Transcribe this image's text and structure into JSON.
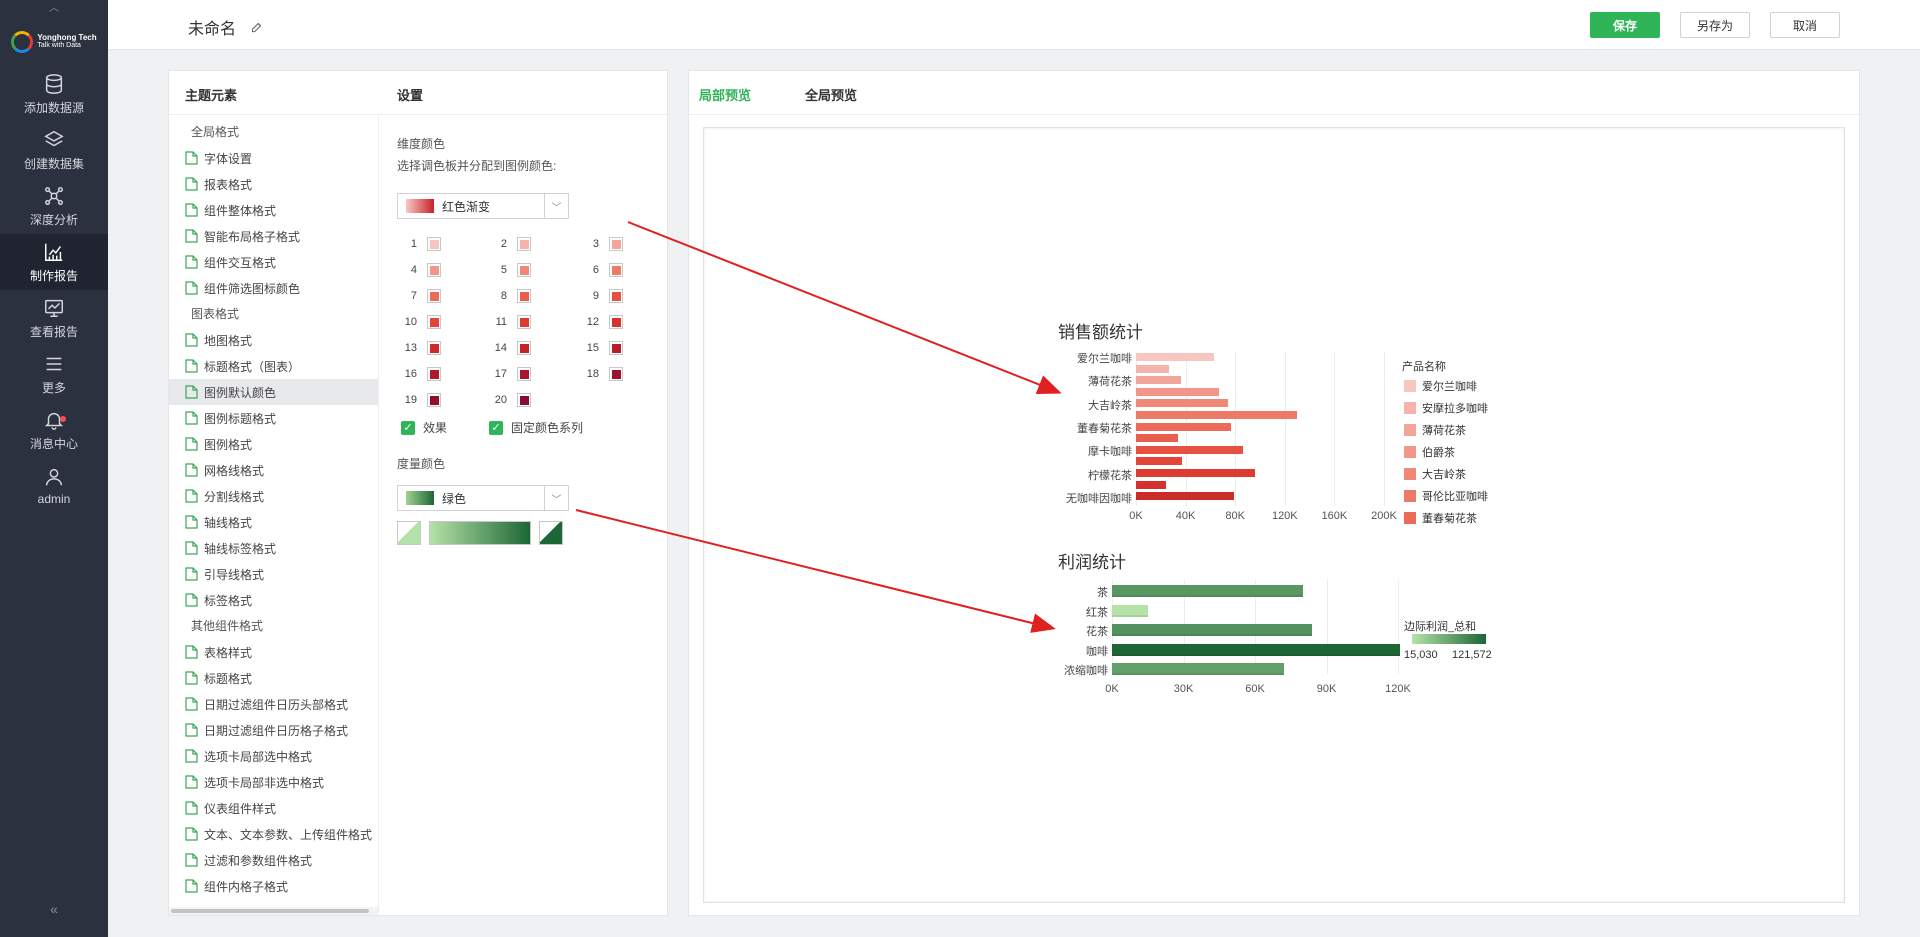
{
  "nav": {
    "logo_name": "Yonghong Tech",
    "logo_tagline": "Talk with Data",
    "items": [
      {
        "label": "添加数据源"
      },
      {
        "label": "创建数据集"
      },
      {
        "label": "深度分析"
      },
      {
        "label": "制作报告"
      },
      {
        "label": "查看报告"
      },
      {
        "label": "更多"
      },
      {
        "label": "消息中心"
      },
      {
        "label": "admin"
      }
    ],
    "collapse_symbol": "«"
  },
  "topbar": {
    "title": "未命名",
    "save_label": "保存",
    "saveas_label": "另存为",
    "cancel_label": "取消"
  },
  "left_panel": {
    "tab_elements": "主题元素",
    "tab_settings": "设置",
    "tree": [
      {
        "type": "group",
        "label": "全局格式"
      },
      {
        "type": "leaf",
        "label": "字体设置"
      },
      {
        "type": "leaf",
        "label": "报表格式"
      },
      {
        "type": "leaf",
        "label": "组件整体格式"
      },
      {
        "type": "leaf",
        "label": "智能布局格子格式"
      },
      {
        "type": "leaf",
        "label": "组件交互格式"
      },
      {
        "type": "leaf",
        "label": "组件筛选图标颜色"
      },
      {
        "type": "group",
        "label": "图表格式"
      },
      {
        "type": "leaf",
        "label": "地图格式"
      },
      {
        "type": "leaf",
        "label": "标题格式（图表）"
      },
      {
        "type": "leaf",
        "label": "图例默认颜色",
        "selected": true
      },
      {
        "type": "leaf",
        "label": "图例标题格式"
      },
      {
        "type": "leaf",
        "label": "图例格式"
      },
      {
        "type": "leaf",
        "label": "网格线格式"
      },
      {
        "type": "leaf",
        "label": "分割线格式"
      },
      {
        "type": "leaf",
        "label": "轴线格式"
      },
      {
        "type": "leaf",
        "label": "轴线标签格式"
      },
      {
        "type": "leaf",
        "label": "引导线格式"
      },
      {
        "type": "leaf",
        "label": "标签格式"
      },
      {
        "type": "group",
        "label": "其他组件格式"
      },
      {
        "type": "leaf",
        "label": "表格样式"
      },
      {
        "type": "leaf",
        "label": "标题格式"
      },
      {
        "type": "leaf",
        "label": "日期过滤组件日历头部格式"
      },
      {
        "type": "leaf",
        "label": "日期过滤组件日历格子格式"
      },
      {
        "type": "leaf",
        "label": "选项卡局部选中格式"
      },
      {
        "type": "leaf",
        "label": "选项卡局部非选中格式"
      },
      {
        "type": "leaf",
        "label": "仪表组件样式"
      },
      {
        "type": "leaf",
        "label": "文本、文本参数、上传组件格式"
      },
      {
        "type": "leaf",
        "label": "过滤和参数组件格式"
      },
      {
        "type": "leaf",
        "label": "组件内格子格式"
      }
    ],
    "settings": {
      "dim_color_label": "维度颜色",
      "dim_color_desc": "选择调色板并分配到图例颜色:",
      "dim_palette": "红色渐变",
      "dim_colors": [
        "#f7c6c1",
        "#f5b3ab",
        "#f3a59a",
        "#f19688",
        "#ef8877",
        "#ed7a67",
        "#eb6b58",
        "#e95e4c",
        "#e55241",
        "#e14638",
        "#dc3b32",
        "#d5312d",
        "#cc2a2b",
        "#c2242a",
        "#b81e2a",
        "#ad1a2b",
        "#a3162c",
        "#99132d",
        "#8f102d",
        "#850d2e"
      ],
      "effect_label": "效果",
      "fixed_series_label": "固定颜色系列",
      "measure_color_label": "度量颜色",
      "measure_palette": "绿色",
      "measure_start": "#b5e2a8",
      "measure_end": "#1d6636"
    }
  },
  "right_panel": {
    "tab_local": "局部预览",
    "tab_global": "全局预览"
  },
  "chart_data": [
    {
      "type": "bar",
      "orientation": "horizontal",
      "title": "销售额统计",
      "categories": [
        "爱尔兰咖啡",
        "薄荷花茶",
        "大吉岭茶",
        "董春菊花茶",
        "摩卡咖啡",
        "柠檬花茶",
        "无咖啡因咖啡"
      ],
      "xlim": [
        0,
        200000
      ],
      "xticks": [
        "0K",
        "40K",
        "80K",
        "120K",
        "160K",
        "200K"
      ],
      "bars": [
        {
          "value": 63000,
          "color": "#f7c6c1"
        },
        {
          "value": 27000,
          "color": "#f5b3ab"
        },
        {
          "value": 36000,
          "color": "#f3a59a"
        },
        {
          "value": 67000,
          "color": "#f19688"
        },
        {
          "value": 74000,
          "color": "#ef8877"
        },
        {
          "value": 130000,
          "color": "#ed7a67"
        },
        {
          "value": 77000,
          "color": "#eb6b58"
        },
        {
          "value": 34000,
          "color": "#e95e4c"
        },
        {
          "value": 86000,
          "color": "#e55241"
        },
        {
          "value": 37000,
          "color": "#e14638"
        },
        {
          "value": 96000,
          "color": "#dc3b32"
        },
        {
          "value": 24000,
          "color": "#d5312d"
        },
        {
          "value": 79000,
          "color": "#cc2a2b"
        }
      ],
      "legend_title": "产品名称",
      "legend": [
        {
          "name": "爱尔兰咖啡",
          "color": "#f7c6c1"
        },
        {
          "name": "安摩拉多咖啡",
          "color": "#f5b3ab"
        },
        {
          "name": "薄荷花茶",
          "color": "#f3a59a"
        },
        {
          "name": "伯爵茶",
          "color": "#f19688"
        },
        {
          "name": "大吉岭茶",
          "color": "#ef8877"
        },
        {
          "name": "哥伦比亚咖啡",
          "color": "#ed7a67"
        },
        {
          "name": "董春菊花茶",
          "color": "#eb6b58"
        }
      ]
    },
    {
      "type": "bar",
      "orientation": "horizontal",
      "title": "利润统计",
      "categories": [
        "茶",
        "红茶",
        "花茶",
        "咖啡",
        "浓缩咖啡"
      ],
      "values": [
        80000,
        15030,
        84000,
        121572,
        72000
      ],
      "xlim": [
        0,
        120000
      ],
      "xticks": [
        "0K",
        "30K",
        "60K",
        "90K",
        "120K"
      ],
      "legend_title": "边际利润_总和",
      "legend_min": "15,030",
      "legend_max": "121,572",
      "color_range": [
        "#b5e2a8",
        "#1d6636"
      ]
    }
  ]
}
